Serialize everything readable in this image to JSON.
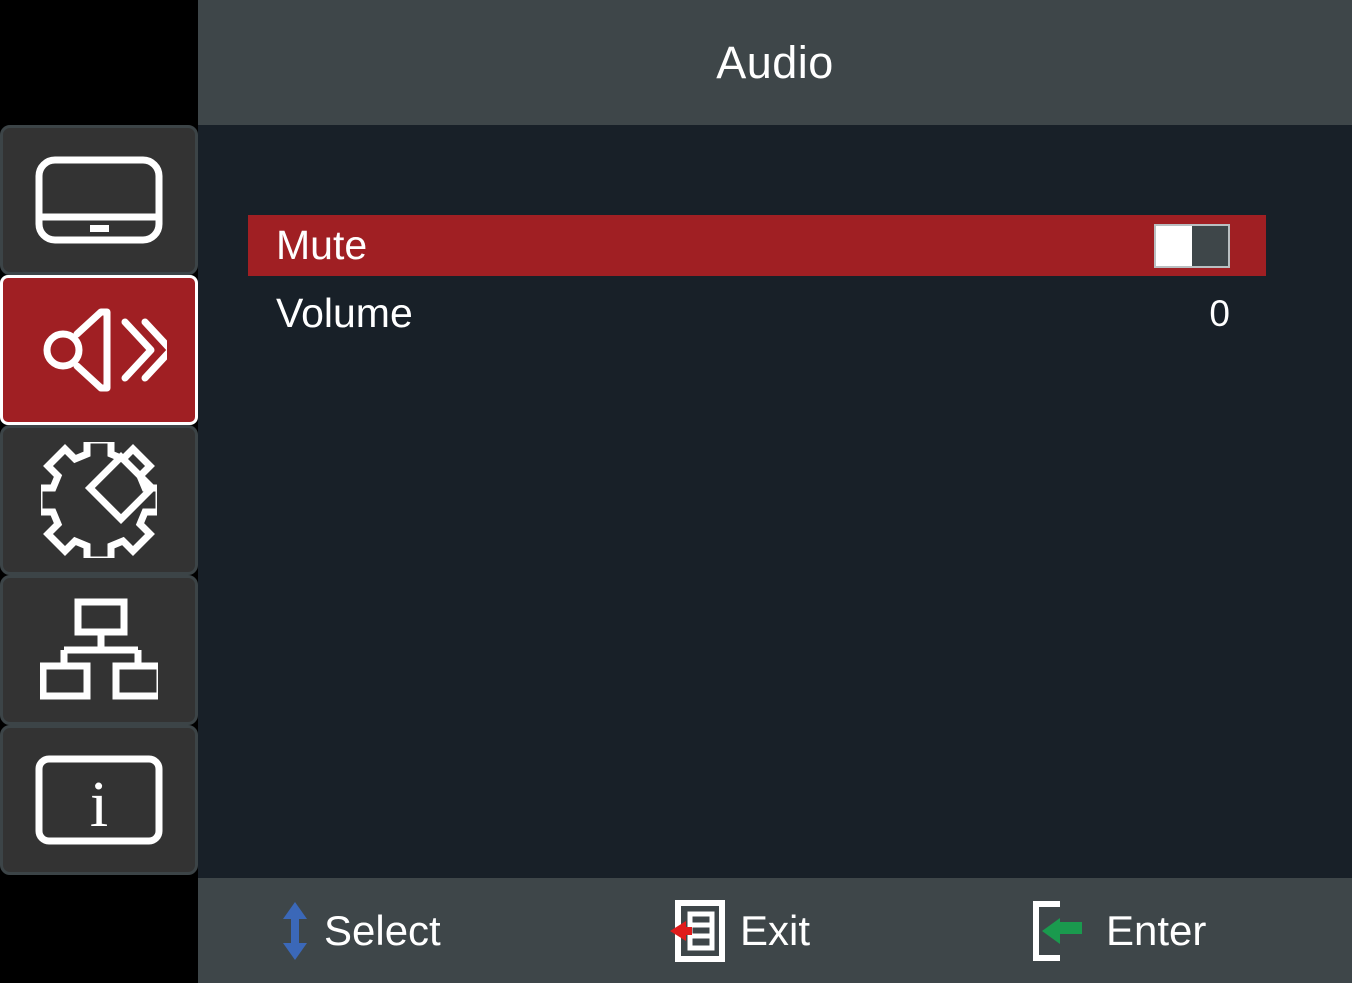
{
  "header": {
    "title": "Audio"
  },
  "sidebar": {
    "items": [
      {
        "id": "display",
        "icon": "monitor-icon",
        "selected": false
      },
      {
        "id": "audio",
        "icon": "speaker-icon",
        "selected": true
      },
      {
        "id": "settings",
        "icon": "gear-icon",
        "selected": false
      },
      {
        "id": "network",
        "icon": "network-icon",
        "selected": false
      },
      {
        "id": "information",
        "icon": "info-icon",
        "selected": false
      }
    ]
  },
  "main": {
    "rows": [
      {
        "label": "Mute",
        "value_type": "toggle",
        "value": "Off",
        "selected": true
      },
      {
        "label": "Volume",
        "value_type": "number",
        "value": "0",
        "selected": false
      }
    ]
  },
  "footer": {
    "items": [
      {
        "label": "Select",
        "icon": "up-down-arrow-icon",
        "color": "#3b68b8"
      },
      {
        "label": "Exit",
        "icon": "exit-menu-icon",
        "color": "#e01b1b"
      },
      {
        "label": "Enter",
        "icon": "enter-return-icon",
        "color": "#1a9a4e"
      }
    ]
  },
  "colors": {
    "header_bg": "#3e4649",
    "content_bg": "#182028",
    "accent_red": "#a01f23",
    "tile_bg": "#333333",
    "sidebar_bg": "#000000",
    "text": "#ffffff",
    "select_blue": "#3b68b8",
    "exit_red": "#e01b1b",
    "enter_green": "#1a9a4e"
  }
}
